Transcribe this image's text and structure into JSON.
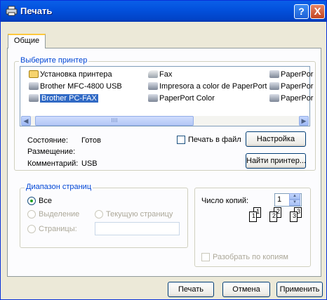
{
  "window": {
    "title": "Печать",
    "help_label": "?",
    "close_label": "X"
  },
  "tabs": [
    {
      "label": "Общие"
    }
  ],
  "printer_group": {
    "legend": "Выберите принтер",
    "printers": [
      {
        "name": "Установка принтера",
        "icon": "add-printer-icon"
      },
      {
        "name": "Brother MFC-4800 USB",
        "icon": "printer-icon"
      },
      {
        "name": "Brother PC-FAX",
        "icon": "printer-icon",
        "selected": true
      },
      {
        "name": "Fax",
        "icon": "fax-icon"
      },
      {
        "name": "Impresora a color de PaperPort",
        "icon": "printer-icon"
      },
      {
        "name": "PaperPort Color",
        "icon": "printer-icon"
      },
      {
        "name": "PaperPor",
        "icon": "printer-icon"
      },
      {
        "name": "PaperPor",
        "icon": "printer-icon"
      },
      {
        "name": "PaperPor",
        "icon": "printer-icon"
      }
    ],
    "scroll_grip": "IIII",
    "status_label": "Состояние:",
    "status_value": "Готов",
    "location_label": "Размещение:",
    "location_value": "",
    "comment_label": "Комментарий:",
    "comment_value": "USB",
    "print_to_file_label": "Печать в файл",
    "print_to_file_checked": false,
    "setup_button": "Настройка",
    "find_printer_button": "Найти принтер..."
  },
  "range_group": {
    "legend": "Диапазон страниц",
    "all_label": "Все",
    "selection_label": "Выделение",
    "current_page_label": "Текущую страницу",
    "pages_label": "Страницы:",
    "pages_value": "",
    "selected": "all"
  },
  "copies_group": {
    "copies_label": "Число копий:",
    "copies_value": "1",
    "collate_label": "Разобрать по копиям",
    "collate_checked": false,
    "collate_pages": [
      "1",
      "1",
      "2",
      "2",
      "3",
      "3"
    ]
  },
  "footer": {
    "print_button": "Печать",
    "cancel_button": "Отмена",
    "apply_button": "Применить"
  },
  "colors": {
    "title_bar": "#0352de",
    "dialog_bg": "#ece9d8",
    "selection": "#316ac5",
    "group_legend": "#0046d5"
  }
}
